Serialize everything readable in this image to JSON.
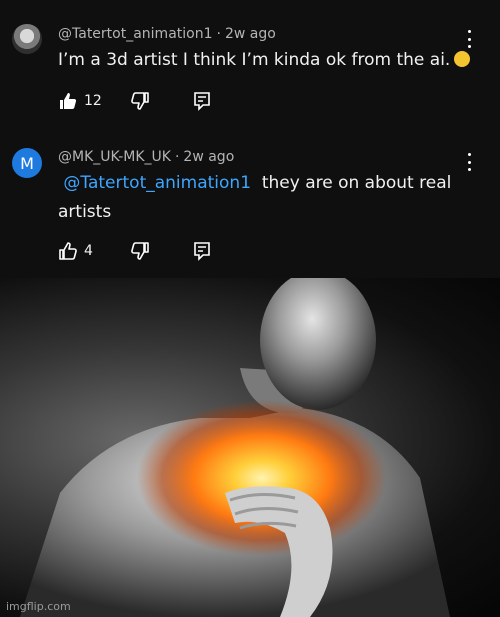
{
  "comments": [
    {
      "author": "@Tatertot_animation1",
      "time": "2w ago",
      "text": "I’m a 3d artist I think I’m kinda ok from the ai.",
      "likes": "12",
      "avatar_icon": "profile-photo-icon"
    },
    {
      "author": "@MK_UK-MK_UK",
      "time": "2w ago",
      "mention": "@Tatertot_animation1",
      "text_line1": "they are on about real",
      "text_line2": "artists",
      "likes": "4",
      "avatar_letter": "M",
      "avatar_color": "#1f7ae0"
    }
  ],
  "image": {
    "watermark": "imgflip.com"
  },
  "colors": {
    "background": "#0f0f0f",
    "mention": "#3ea6ff",
    "glow": "#ff8a1c"
  }
}
